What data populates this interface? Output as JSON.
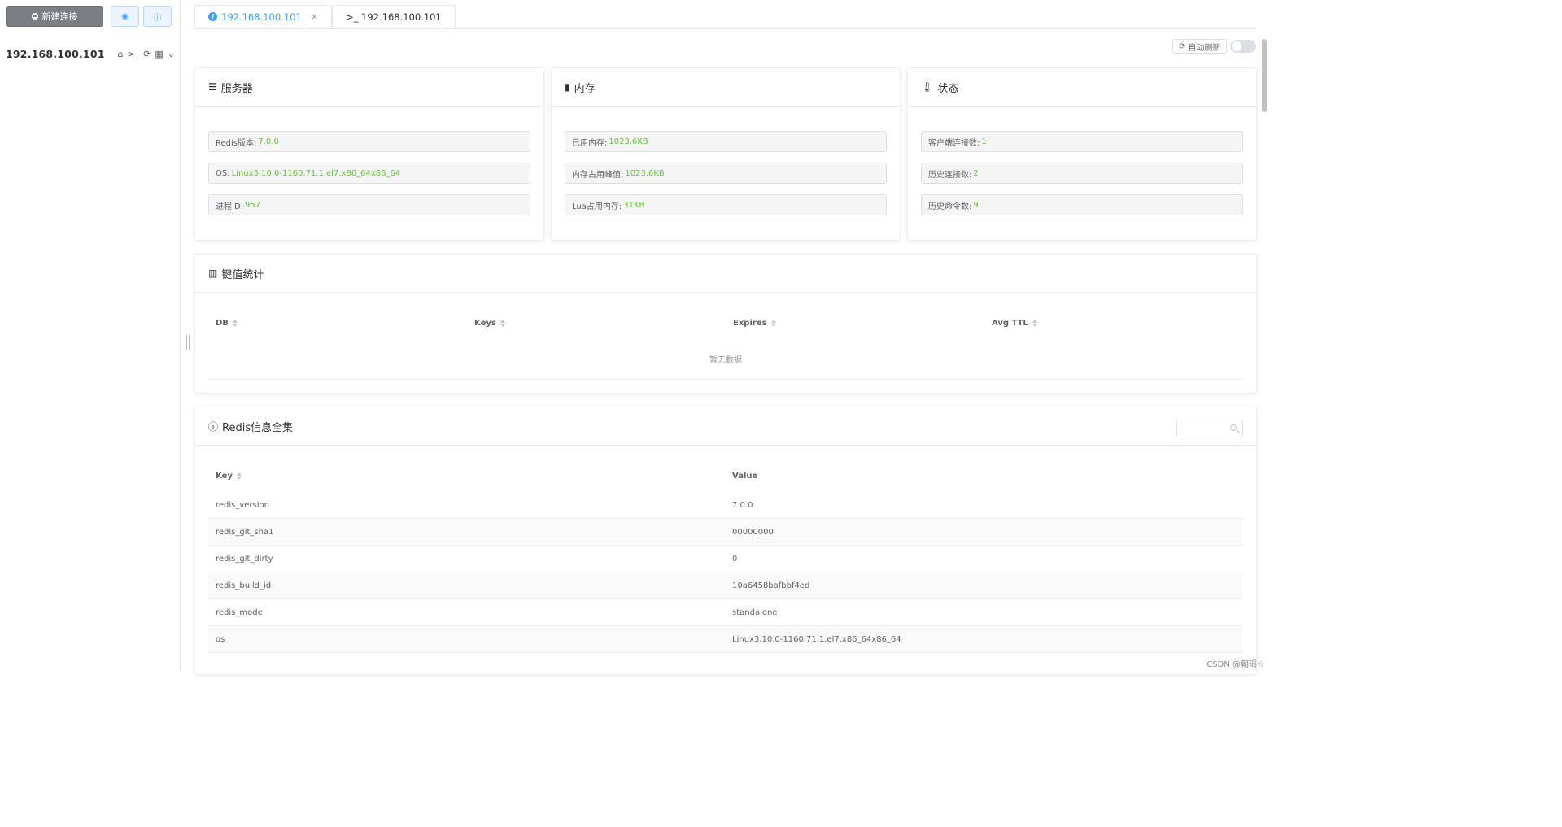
{
  "sidebar": {
    "new_connection_label": "新建连接",
    "connection_name": "192.168.100.101"
  },
  "tabs": [
    {
      "label": "192.168.100.101",
      "active": true
    },
    {
      "label": ">_ 192.168.100.101",
      "active": false
    }
  ],
  "toolbar": {
    "auto_refresh_label": "自动刷新",
    "auto_refresh_enabled": false
  },
  "server_card": {
    "title": "服务器",
    "rows": [
      {
        "label": "Redis版本:",
        "value": "7.0.0"
      },
      {
        "label": "OS:",
        "value": "Linux3.10.0-1160.71.1.el7.x86_64x86_64"
      },
      {
        "label": "进程ID:",
        "value": "957"
      }
    ]
  },
  "memory_card": {
    "title": "内存",
    "rows": [
      {
        "label": "已用内存:",
        "value": "1023.6KB"
      },
      {
        "label": "内存占用峰值:",
        "value": "1023.6KB"
      },
      {
        "label": "Lua占用内存:",
        "value": "31KB"
      }
    ]
  },
  "status_card": {
    "title": "状态",
    "rows": [
      {
        "label": "客户端连接数:",
        "value": "1"
      },
      {
        "label": "历史连接数:",
        "value": "2"
      },
      {
        "label": "历史命令数:",
        "value": "9"
      }
    ]
  },
  "key_stats": {
    "title": "键值统计",
    "columns": [
      "DB",
      "Keys",
      "Expires",
      "Avg TTL"
    ],
    "empty_text": "暂无数据"
  },
  "redis_info": {
    "title": "Redis信息全集",
    "search_placeholder": "",
    "columns": [
      "Key",
      "Value"
    ],
    "rows": [
      {
        "key": "redis_version",
        "value": "7.0.0"
      },
      {
        "key": "redis_git_sha1",
        "value": "00000000"
      },
      {
        "key": "redis_git_dirty",
        "value": "0"
      },
      {
        "key": "redis_build_id",
        "value": "10a6458bafbbf4ed"
      },
      {
        "key": "redis_mode",
        "value": "standalone"
      },
      {
        "key": "os",
        "value": "Linux3.10.0-1160.71.1.el7.x86_64x86_64"
      }
    ]
  },
  "watermark": "CSDN @朝瑶☆",
  "colors": {
    "accent": "#409eff",
    "value_green": "#67c23a"
  }
}
